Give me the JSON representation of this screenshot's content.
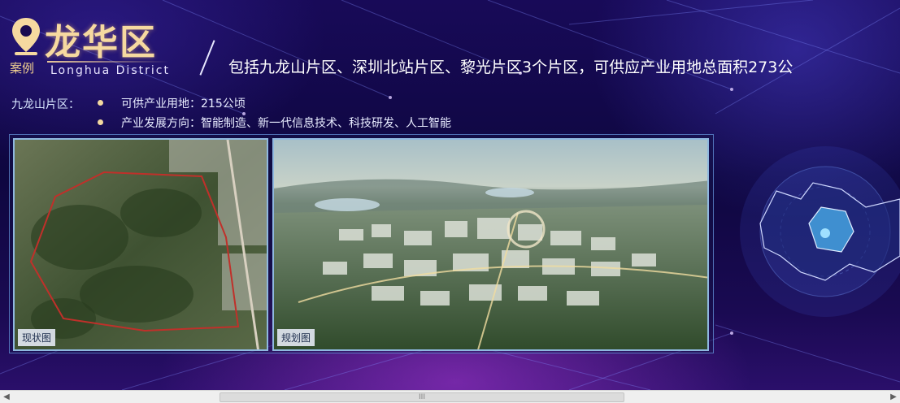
{
  "header": {
    "title_cn": "龙华区",
    "case_label": "案例",
    "title_en": "Longhua District",
    "headline": "包括九龙山片区、深圳北站片区、黎光片区3个片区，可供应产业用地总面积273公"
  },
  "info": {
    "area_label": "九龙山片区：",
    "bullets": [
      "可供产业用地：215公顷",
      "产业发展方向：智能制造、新一代信息技术、科技研发、人工智能"
    ]
  },
  "images": {
    "current_label": "现状图",
    "plan_label": "规划图"
  },
  "scrollbar": {
    "left_arrow": "◀",
    "right_arrow": "▶",
    "thumb_grip": "III"
  },
  "icons": [
    "location-pin-icon",
    "district-map-icon"
  ],
  "colors": {
    "title_gold": "#f6d9a0",
    "background": "#0e0740",
    "accent_purple": "#b43cdc"
  }
}
